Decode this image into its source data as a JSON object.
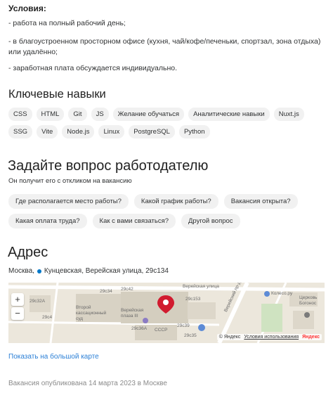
{
  "conditions": {
    "title": "Условия:",
    "items": [
      "- работа на полный рабочий день;",
      "- в благоустроенном просторном офисе (кухня, чай/кофе/печеньки, спортзал, зона отдыха) или удалённо;",
      "- заработная плата обсуждается индивидуально."
    ]
  },
  "skills": {
    "title": "Ключевые навыки",
    "items": [
      "CSS",
      "HTML",
      "Git",
      "JS",
      "Желание обучаться",
      "Аналитические навыки",
      "Nuxt.js",
      "SSG",
      "Vite",
      "Node.js",
      "Linux",
      "PostgreSQL",
      "Python"
    ]
  },
  "ask": {
    "title": "Задайте вопрос работодателю",
    "subtitle": "Он получит его с откликом на вакансию",
    "questions_row1": [
      "Где располагается место работы?",
      "Какой график работы?",
      "Вакансия открыта?"
    ],
    "questions_row2": [
      "Какая оплата труда?",
      "Как с вами связаться?",
      "Другой вопрос"
    ]
  },
  "address": {
    "title": "Адрес",
    "city": "Москва,",
    "metro_color": "#0078c9",
    "metro_and_street": "Кунцевская, Верейская улица, 29с134"
  },
  "map": {
    "zoom_in": "+",
    "zoom_out": "−",
    "labels": {
      "ver_street": "Верейская улица",
      "kolesa": "Колесо.ру",
      "b29s32a": "29с32А",
      "b29s42": "29с42",
      "b29s34": "29с34",
      "b29s153": "29с153",
      "b29s4": "29с4",
      "b29s36a": "29с36А",
      "b29s39": "29с39",
      "building_third": "Второй кассационный суд",
      "building_plaza": "Верейская плаза III",
      "sssr": "СССР",
      "b29s35": "29с35",
      "church": "Церковь Богонос",
      "proezd": "Верейский пр-д"
    },
    "attribution": {
      "yandex": "© Яндекс",
      "terms": "Условия использования",
      "brand": "Яндекс"
    }
  },
  "links": {
    "big_map": "Показать на большой карте"
  },
  "published": "Вакансия опубликована 14 марта 2023 в Москве"
}
